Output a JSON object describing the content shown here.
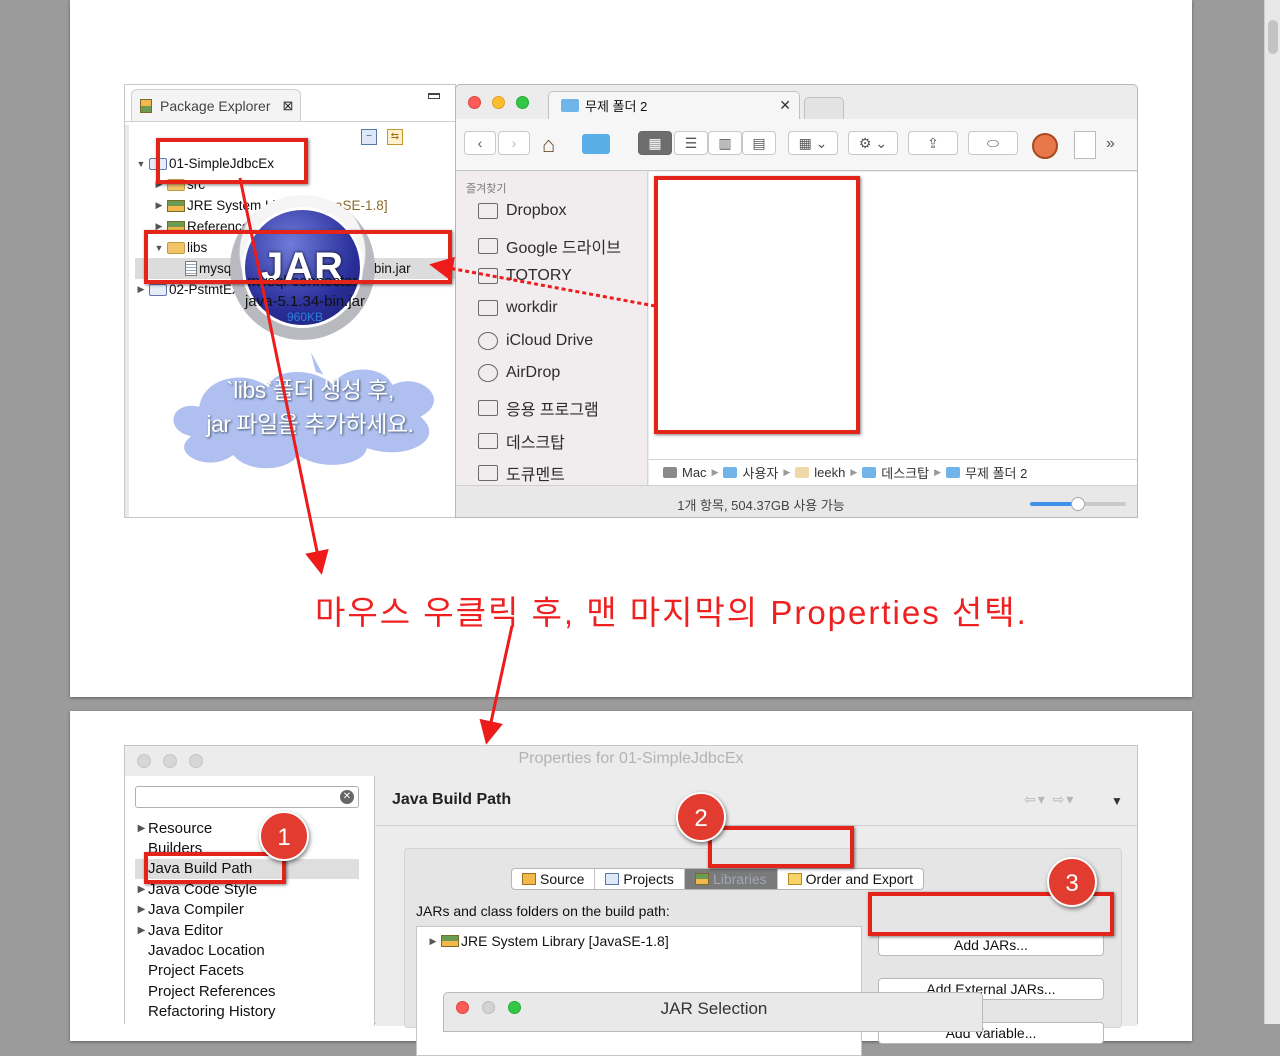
{
  "package_explorer": {
    "tab_label": "Package Explorer",
    "tree": [
      {
        "label": "01-SimpleJdbcEx",
        "expanded": true,
        "indent": 0,
        "icon": "project-icon"
      },
      {
        "label": "src",
        "indent": 1,
        "icon": "package-folder-icon"
      },
      {
        "label": "JRE System Library",
        "suffix": "[JavaSE-1.8]",
        "indent": 1,
        "icon": "library-icon"
      },
      {
        "label": "Referenced Libraries",
        "indent": 1,
        "icon": "library-icon"
      },
      {
        "label": "libs",
        "expanded": true,
        "indent": 1,
        "icon": "folder-icon"
      },
      {
        "label": "mysql-connector-java-5.1.34-bin.jar",
        "indent": 2,
        "icon": "jar-file-icon"
      },
      {
        "label": "02-PstmtEx",
        "indent": 0,
        "icon": "project-icon"
      }
    ]
  },
  "finder": {
    "tab_title": "무제 폴더 2",
    "sidebar_heading": "즐겨찾기",
    "sidebar_items": [
      {
        "label": "Dropbox",
        "icon": "dropbox-icon"
      },
      {
        "label": "Google 드라이브",
        "icon": "folder-icon"
      },
      {
        "label": "TOTORY",
        "icon": "folder-icon"
      },
      {
        "label": "workdir",
        "icon": "folder-icon"
      },
      {
        "label": "iCloud Drive",
        "icon": "cloud-icon"
      },
      {
        "label": "AirDrop",
        "icon": "airdrop-icon"
      },
      {
        "label": "응용 프로그램",
        "icon": "applications-icon"
      },
      {
        "label": "데스크탑",
        "icon": "desktop-icon"
      },
      {
        "label": "도큐멘트",
        "icon": "document-icon"
      }
    ],
    "file": {
      "name_line1": "mysql-connector-",
      "name_line2": "java-5.1.34-bin.jar",
      "size": "960KB",
      "icon_text": "JAR"
    },
    "path": [
      "Mac",
      "사용자",
      "leekh",
      "데스크탑",
      "무제 폴더 2"
    ],
    "status": "1개 항목, 504.37GB 사용 가능",
    "icon_size_fraction": 0.5
  },
  "annotations": {
    "callout_line1": "`libs`폴더 생성 후,",
    "callout_line2": "jar 파일을 추가하세요.",
    "instruction": "마우스 우클릭 후, 맨 마지막의 Properties 선택."
  },
  "properties_dialog": {
    "title": "Properties for 01-SimpleJdbcEx",
    "nav_items": [
      {
        "label": "Resource",
        "expandable": true
      },
      {
        "label": "Builders",
        "expandable": false
      },
      {
        "label": "Java Build Path",
        "expandable": false,
        "selected": true
      },
      {
        "label": "Java Code Style",
        "expandable": true
      },
      {
        "label": "Java Compiler",
        "expandable": true
      },
      {
        "label": "Java Editor",
        "expandable": true
      },
      {
        "label": "Javadoc Location",
        "expandable": false
      },
      {
        "label": "Project Facets",
        "expandable": false
      },
      {
        "label": "Project References",
        "expandable": false
      },
      {
        "label": "Refactoring History",
        "expandable": false
      }
    ],
    "heading": "Java Build Path",
    "tabs": [
      {
        "label": "Source",
        "active": false
      },
      {
        "label": "Projects",
        "active": false
      },
      {
        "label": "Libraries",
        "active": true
      },
      {
        "label": "Order and Export",
        "active": false
      }
    ],
    "build_path_label": "JARs and class folders on the build path:",
    "library_entry": "JRE System Library [JavaSE-1.8]",
    "buttons": [
      "Add JARs...",
      "Add External JARs...",
      "Add Variable..."
    ],
    "badges": [
      "1",
      "2",
      "3"
    ]
  },
  "jar_selection": {
    "title": "JAR Selection"
  },
  "colors": {
    "accent_red": "#e3241b",
    "note_red": "#ee2020",
    "callout_blue": "#aebff0"
  }
}
